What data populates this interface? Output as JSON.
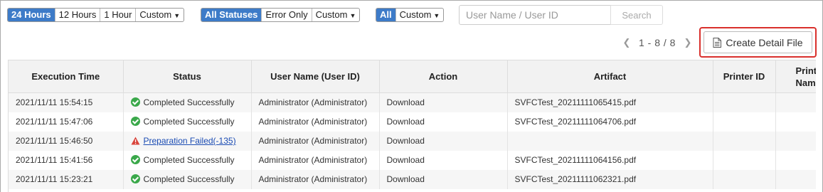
{
  "filters": {
    "time_options": [
      "24 Hours",
      "12 Hours",
      "1 Hour",
      "Custom"
    ],
    "time_active": "24 Hours",
    "status_options": [
      "All Statuses",
      "Error Only",
      "Custom"
    ],
    "status_active": "All Statuses",
    "action_options": [
      "All",
      "Custom"
    ],
    "action_active": "All"
  },
  "search": {
    "placeholder": "User Name / User ID",
    "value": "",
    "button_label": "Search"
  },
  "pager": {
    "range": "1 - 8 / 8",
    "prev_icon": "chevron-left-icon",
    "next_icon": "chevron-right-icon"
  },
  "detail_button": {
    "label": "Create Detail File",
    "icon": "document-icon",
    "highlight_color": "#d9302c"
  },
  "table": {
    "columns": [
      "Execution Time",
      "Status",
      "User Name (User ID)",
      "Action",
      "Artifact",
      "Printer ID",
      "Printer Name"
    ],
    "rows": [
      {
        "time": "2021/11/11 15:54:15",
        "status": "Completed Successfully",
        "status_type": "ok",
        "user": "Administrator (Administrator)",
        "action": "Download",
        "artifact": "SVFCTest_20211111065415.pdf",
        "printer_id": "",
        "printer_name": ""
      },
      {
        "time": "2021/11/11 15:47:06",
        "status": "Completed Successfully",
        "status_type": "ok",
        "user": "Administrator (Administrator)",
        "action": "Download",
        "artifact": "SVFCTest_20211111064706.pdf",
        "printer_id": "",
        "printer_name": ""
      },
      {
        "time": "2021/11/11 15:46:50",
        "status": "Preparation Failed(-135)",
        "status_type": "error",
        "user": "Administrator (Administrator)",
        "action": "Download",
        "artifact": "",
        "printer_id": "",
        "printer_name": ""
      },
      {
        "time": "2021/11/11 15:41:56",
        "status": "Completed Successfully",
        "status_type": "ok",
        "user": "Administrator (Administrator)",
        "action": "Download",
        "artifact": "SVFCTest_20211111064156.pdf",
        "printer_id": "",
        "printer_name": ""
      },
      {
        "time": "2021/11/11 15:23:21",
        "status": "Completed Successfully",
        "status_type": "ok",
        "user": "Administrator (Administrator)",
        "action": "Download",
        "artifact": "SVFCTest_20211111062321.pdf",
        "printer_id": "",
        "printer_name": ""
      }
    ]
  },
  "colors": {
    "accent": "#3d7bc8",
    "success": "#3aa84a",
    "error": "#d9443b",
    "link": "#1a4bb3"
  }
}
